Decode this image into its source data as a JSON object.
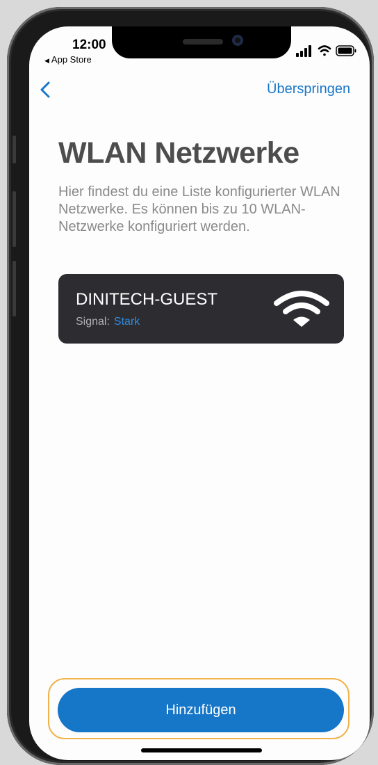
{
  "status_bar": {
    "time": "12:00",
    "back_app": "App Store",
    "icons": [
      "cellular-signal-icon",
      "wifi-icon",
      "battery-icon"
    ]
  },
  "nav": {
    "back_icon": "chevron-left-icon",
    "skip_label": "Überspringen"
  },
  "page": {
    "title": "WLAN Netzwerke",
    "description": "Hier findest  du eine Liste konfigurierter WLAN Netzwerke. Es können bis zu 10 WLAN-Netzwerke konfiguriert werden."
  },
  "networks": [
    {
      "name": "DINITECH-GUEST",
      "signal_label": "Signal:",
      "signal_value": "Stark",
      "icon": "wifi-strong-icon"
    }
  ],
  "actions": {
    "add_label": "Hinzufügen"
  },
  "colors": {
    "accent": "#1676c7",
    "link": "#1877c8",
    "card_bg": "#2d2d31",
    "signal_value": "#2f8be0",
    "focus_ring": "#f0b24a"
  }
}
